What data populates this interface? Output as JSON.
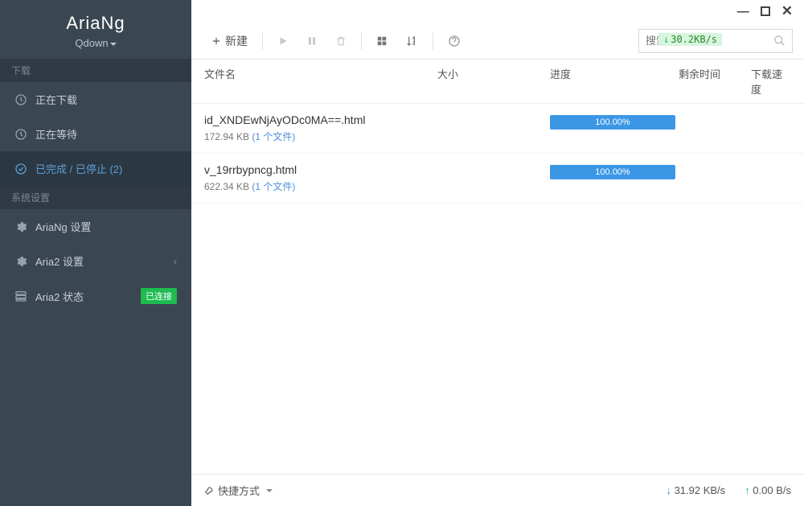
{
  "brand": {
    "title": "AriaNg",
    "subtitle": "Qdown"
  },
  "sidebar": {
    "downloads_label": "下载",
    "settings_label": "系统设置",
    "items": [
      {
        "label": "正在下载"
      },
      {
        "label": "正在等待"
      },
      {
        "label": "已完成 / 已停止 (2)"
      }
    ],
    "settings": [
      {
        "label": "AriaNg 设置"
      },
      {
        "label": "Aria2 设置"
      },
      {
        "label": "Aria2 状态"
      }
    ],
    "connected_badge": "已连接"
  },
  "toolbar": {
    "new_label": "新建",
    "search_placeholder": "搜索",
    "speed_hint": "30.2KB/s"
  },
  "columns": {
    "name": "文件名",
    "size": "大小",
    "progress": "进度",
    "time": "剩余时间",
    "speed": "下载速度"
  },
  "files": [
    {
      "name": "id_XNDEwNjAyODc0MA==.html",
      "size": "172.94 KB",
      "count": "(1 个文件)",
      "progress": "100.00%"
    },
    {
      "name": "v_19rrbypncg.html",
      "size": "622.34 KB",
      "count": "(1 个文件)",
      "progress": "100.00%"
    }
  ],
  "footer": {
    "shortcut": "快捷方式",
    "download_speed": "31.92 KB/s",
    "upload_speed": "0.00 B/s"
  }
}
